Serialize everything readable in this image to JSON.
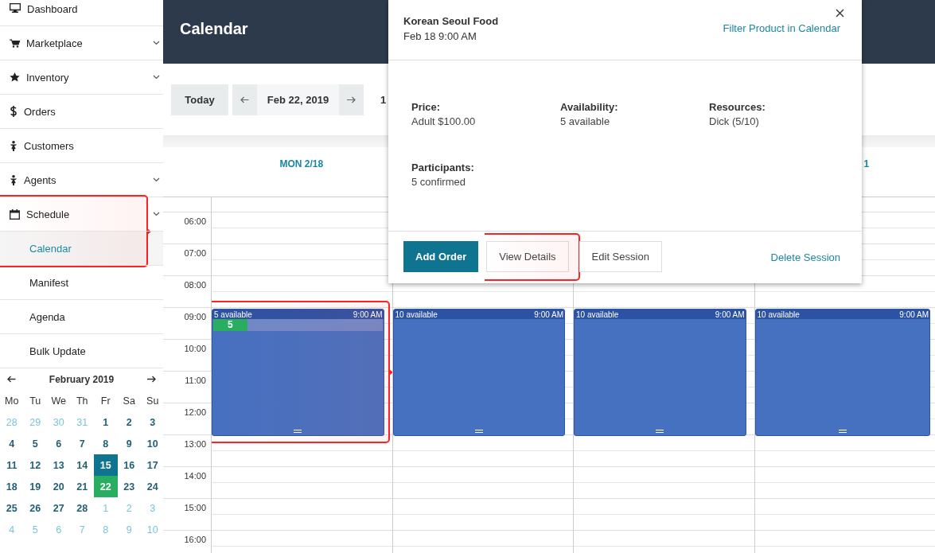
{
  "sidebar": {
    "items": [
      {
        "label": "Dashboard",
        "expandable": false,
        "selected": false
      },
      {
        "label": "Marketplace",
        "expandable": true,
        "selected": false
      },
      {
        "label": "Inventory",
        "expandable": true,
        "selected": false
      },
      {
        "label": "Orders",
        "expandable": false,
        "selected": false
      },
      {
        "label": "Customers",
        "expandable": false,
        "selected": false
      },
      {
        "label": "Agents",
        "expandable": true,
        "selected": false
      },
      {
        "label": "Schedule",
        "expandable": true,
        "selected": false,
        "children": [
          {
            "label": "Calendar",
            "selected": true,
            "highlighted": true
          },
          {
            "label": "Manifest",
            "selected": false,
            "highlighted": false
          },
          {
            "label": "Agenda",
            "selected": false,
            "highlighted": false
          },
          {
            "label": "Bulk Update",
            "selected": false,
            "highlighted": false
          }
        ]
      }
    ]
  },
  "mini_calendar": {
    "month": "February 2019",
    "weekdays": [
      "Mo",
      "Tu",
      "We",
      "Th",
      "Fr",
      "Sa",
      "Su"
    ],
    "weeks": [
      [
        {
          "day": "28",
          "outside": true,
          "selected": false,
          "today": false
        },
        {
          "day": "29",
          "outside": true,
          "selected": false,
          "today": false
        },
        {
          "day": "30",
          "outside": true,
          "selected": false,
          "today": false
        },
        {
          "day": "31",
          "outside": true,
          "selected": false,
          "today": false
        },
        {
          "day": "1",
          "outside": false,
          "selected": false,
          "today": false
        },
        {
          "day": "2",
          "outside": false,
          "selected": false,
          "today": false
        },
        {
          "day": "3",
          "outside": false,
          "selected": false,
          "today": false
        }
      ],
      [
        {
          "day": "4",
          "outside": false,
          "selected": false,
          "today": false
        },
        {
          "day": "5",
          "outside": false,
          "selected": false,
          "today": false
        },
        {
          "day": "6",
          "outside": false,
          "selected": false,
          "today": false
        },
        {
          "day": "7",
          "outside": false,
          "selected": false,
          "today": false
        },
        {
          "day": "8",
          "outside": false,
          "selected": false,
          "today": false
        },
        {
          "day": "9",
          "outside": false,
          "selected": false,
          "today": false
        },
        {
          "day": "10",
          "outside": false,
          "selected": false,
          "today": false
        }
      ],
      [
        {
          "day": "11",
          "outside": false,
          "selected": false,
          "today": false
        },
        {
          "day": "12",
          "outside": false,
          "selected": false,
          "today": false
        },
        {
          "day": "13",
          "outside": false,
          "selected": false,
          "today": false
        },
        {
          "day": "14",
          "outside": false,
          "selected": false,
          "today": false
        },
        {
          "day": "15",
          "outside": false,
          "selected": true,
          "today": false
        },
        {
          "day": "16",
          "outside": false,
          "selected": false,
          "today": false
        },
        {
          "day": "17",
          "outside": false,
          "selected": false,
          "today": false
        }
      ],
      [
        {
          "day": "18",
          "outside": false,
          "selected": false,
          "today": false
        },
        {
          "day": "19",
          "outside": false,
          "selected": false,
          "today": false
        },
        {
          "day": "20",
          "outside": false,
          "selected": false,
          "today": false
        },
        {
          "day": "21",
          "outside": false,
          "selected": false,
          "today": false
        },
        {
          "day": "22",
          "outside": false,
          "selected": false,
          "today": true
        },
        {
          "day": "23",
          "outside": false,
          "selected": false,
          "today": false
        },
        {
          "day": "24",
          "outside": false,
          "selected": false,
          "today": false
        }
      ],
      [
        {
          "day": "25",
          "outside": false,
          "selected": false,
          "today": false
        },
        {
          "day": "26",
          "outside": false,
          "selected": false,
          "today": false
        },
        {
          "day": "27",
          "outside": false,
          "selected": false,
          "today": false
        },
        {
          "day": "28",
          "outside": false,
          "selected": false,
          "today": false
        },
        {
          "day": "1",
          "outside": true,
          "selected": false,
          "today": false
        },
        {
          "day": "2",
          "outside": true,
          "selected": false,
          "today": false
        },
        {
          "day": "3",
          "outside": true,
          "selected": false,
          "today": false
        }
      ],
      [
        {
          "day": "4",
          "outside": true,
          "selected": false,
          "today": false
        },
        {
          "day": "5",
          "outside": true,
          "selected": false,
          "today": false
        },
        {
          "day": "6",
          "outside": true,
          "selected": false,
          "today": false
        },
        {
          "day": "7",
          "outside": true,
          "selected": false,
          "today": false
        },
        {
          "day": "8",
          "outside": true,
          "selected": false,
          "today": false
        },
        {
          "day": "9",
          "outside": true,
          "selected": false,
          "today": false
        },
        {
          "day": "10",
          "outside": true,
          "selected": false,
          "today": false
        }
      ]
    ]
  },
  "header": {
    "title": "Calendar"
  },
  "toolbar": {
    "today_button": "Today",
    "date": "Feb 22, 2019",
    "range_text": "1"
  },
  "calendar": {
    "times": [
      "06:00",
      "07:00",
      "08:00",
      "09:00",
      "10:00",
      "11:00",
      "12:00",
      "13:00",
      "14:00",
      "15:00",
      "16:00"
    ],
    "columns": [
      {
        "header": "MON 2/18",
        "event": {
          "availability": "5 available",
          "time": "9:00 AM",
          "booked": "5",
          "level": 0.2,
          "highlighted": true
        }
      },
      {
        "event": {
          "availability": "10 available",
          "time": "9:00 AM",
          "highlighted": false
        }
      },
      {
        "event": {
          "availability": "10 available",
          "time": "9:00 AM",
          "highlighted": false
        }
      },
      {
        "header": "1",
        "event": {
          "availability": "10 available",
          "time": "9:00 AM",
          "highlighted": false
        }
      }
    ]
  },
  "popup": {
    "title": "Korean Seoul Food",
    "subtitle": "Feb 18 9:00 AM",
    "link": "Filter Product in Calendar",
    "fields": [
      {
        "label": "Price:",
        "value": "Adult $100.00"
      },
      {
        "label": "Availability:",
        "value": "5 available"
      },
      {
        "label": "Resources:",
        "value": "Dick (5/10)"
      },
      {
        "label": "Participants:",
        "value": "5 confirmed"
      }
    ],
    "buttons": [
      {
        "label": "Add Order",
        "kind": "primary",
        "highlighted": false
      },
      {
        "label": "View Details",
        "kind": "default",
        "highlighted": true
      },
      {
        "label": "Edit Session",
        "kind": "default",
        "highlighted": false
      }
    ],
    "delete_link": "Delete Session"
  }
}
